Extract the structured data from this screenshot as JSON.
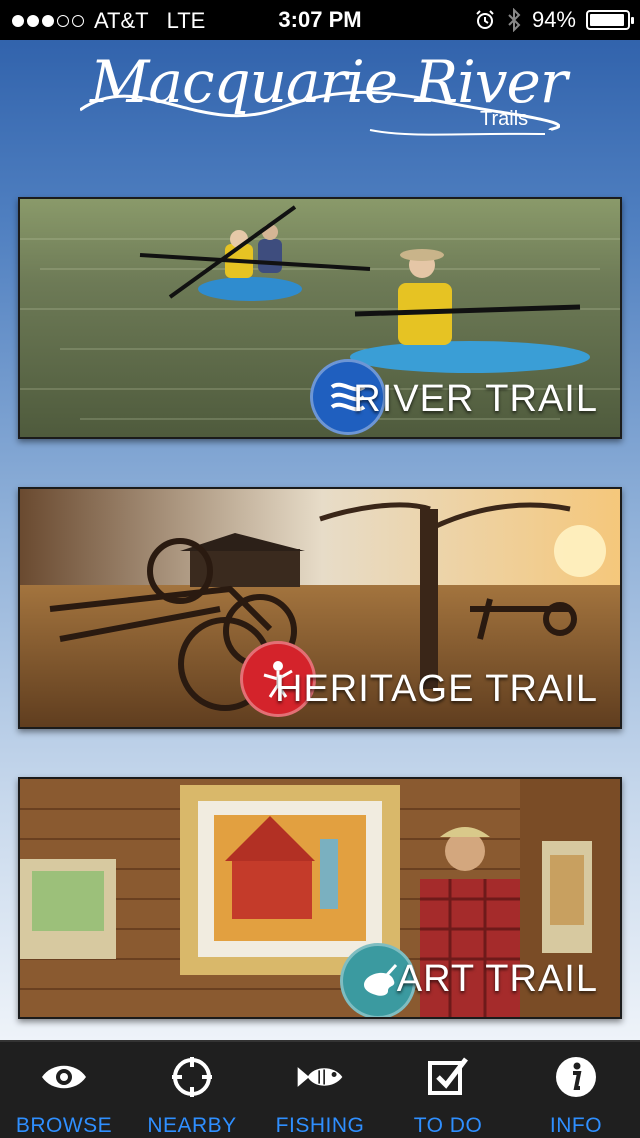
{
  "status_bar": {
    "signal_bars_filled": 3,
    "signal_bars_total": 5,
    "carrier": "AT&T",
    "network": "LTE",
    "time": "3:07 PM",
    "battery_percent": "94%",
    "battery_level": 0.94,
    "icons": [
      "alarm-icon",
      "bluetooth-icon",
      "battery-icon"
    ]
  },
  "logo": {
    "title": "Macquarie River",
    "subtitle": "Trails"
  },
  "trails": [
    {
      "label": "RIVER TRAIL",
      "icon": "river-wave-icon",
      "badge_color": "#1f5fbf"
    },
    {
      "label": "HERITAGE TRAIL",
      "icon": "heritage-figure-icon",
      "badge_color": "#d4232b"
    },
    {
      "label": "ART TRAIL",
      "icon": "palette-icon",
      "badge_color": "#3b9aa0"
    }
  ],
  "tab_bar": {
    "accent_color": "#2f8fff",
    "tabs": [
      {
        "label": "BROWSE",
        "icon": "eye-icon"
      },
      {
        "label": "NEARBY",
        "icon": "crosshair-icon"
      },
      {
        "label": "FISHING",
        "icon": "fish-icon"
      },
      {
        "label": "TO DO",
        "icon": "checkbox-icon"
      },
      {
        "label": "INFO",
        "icon": "info-icon"
      }
    ]
  }
}
